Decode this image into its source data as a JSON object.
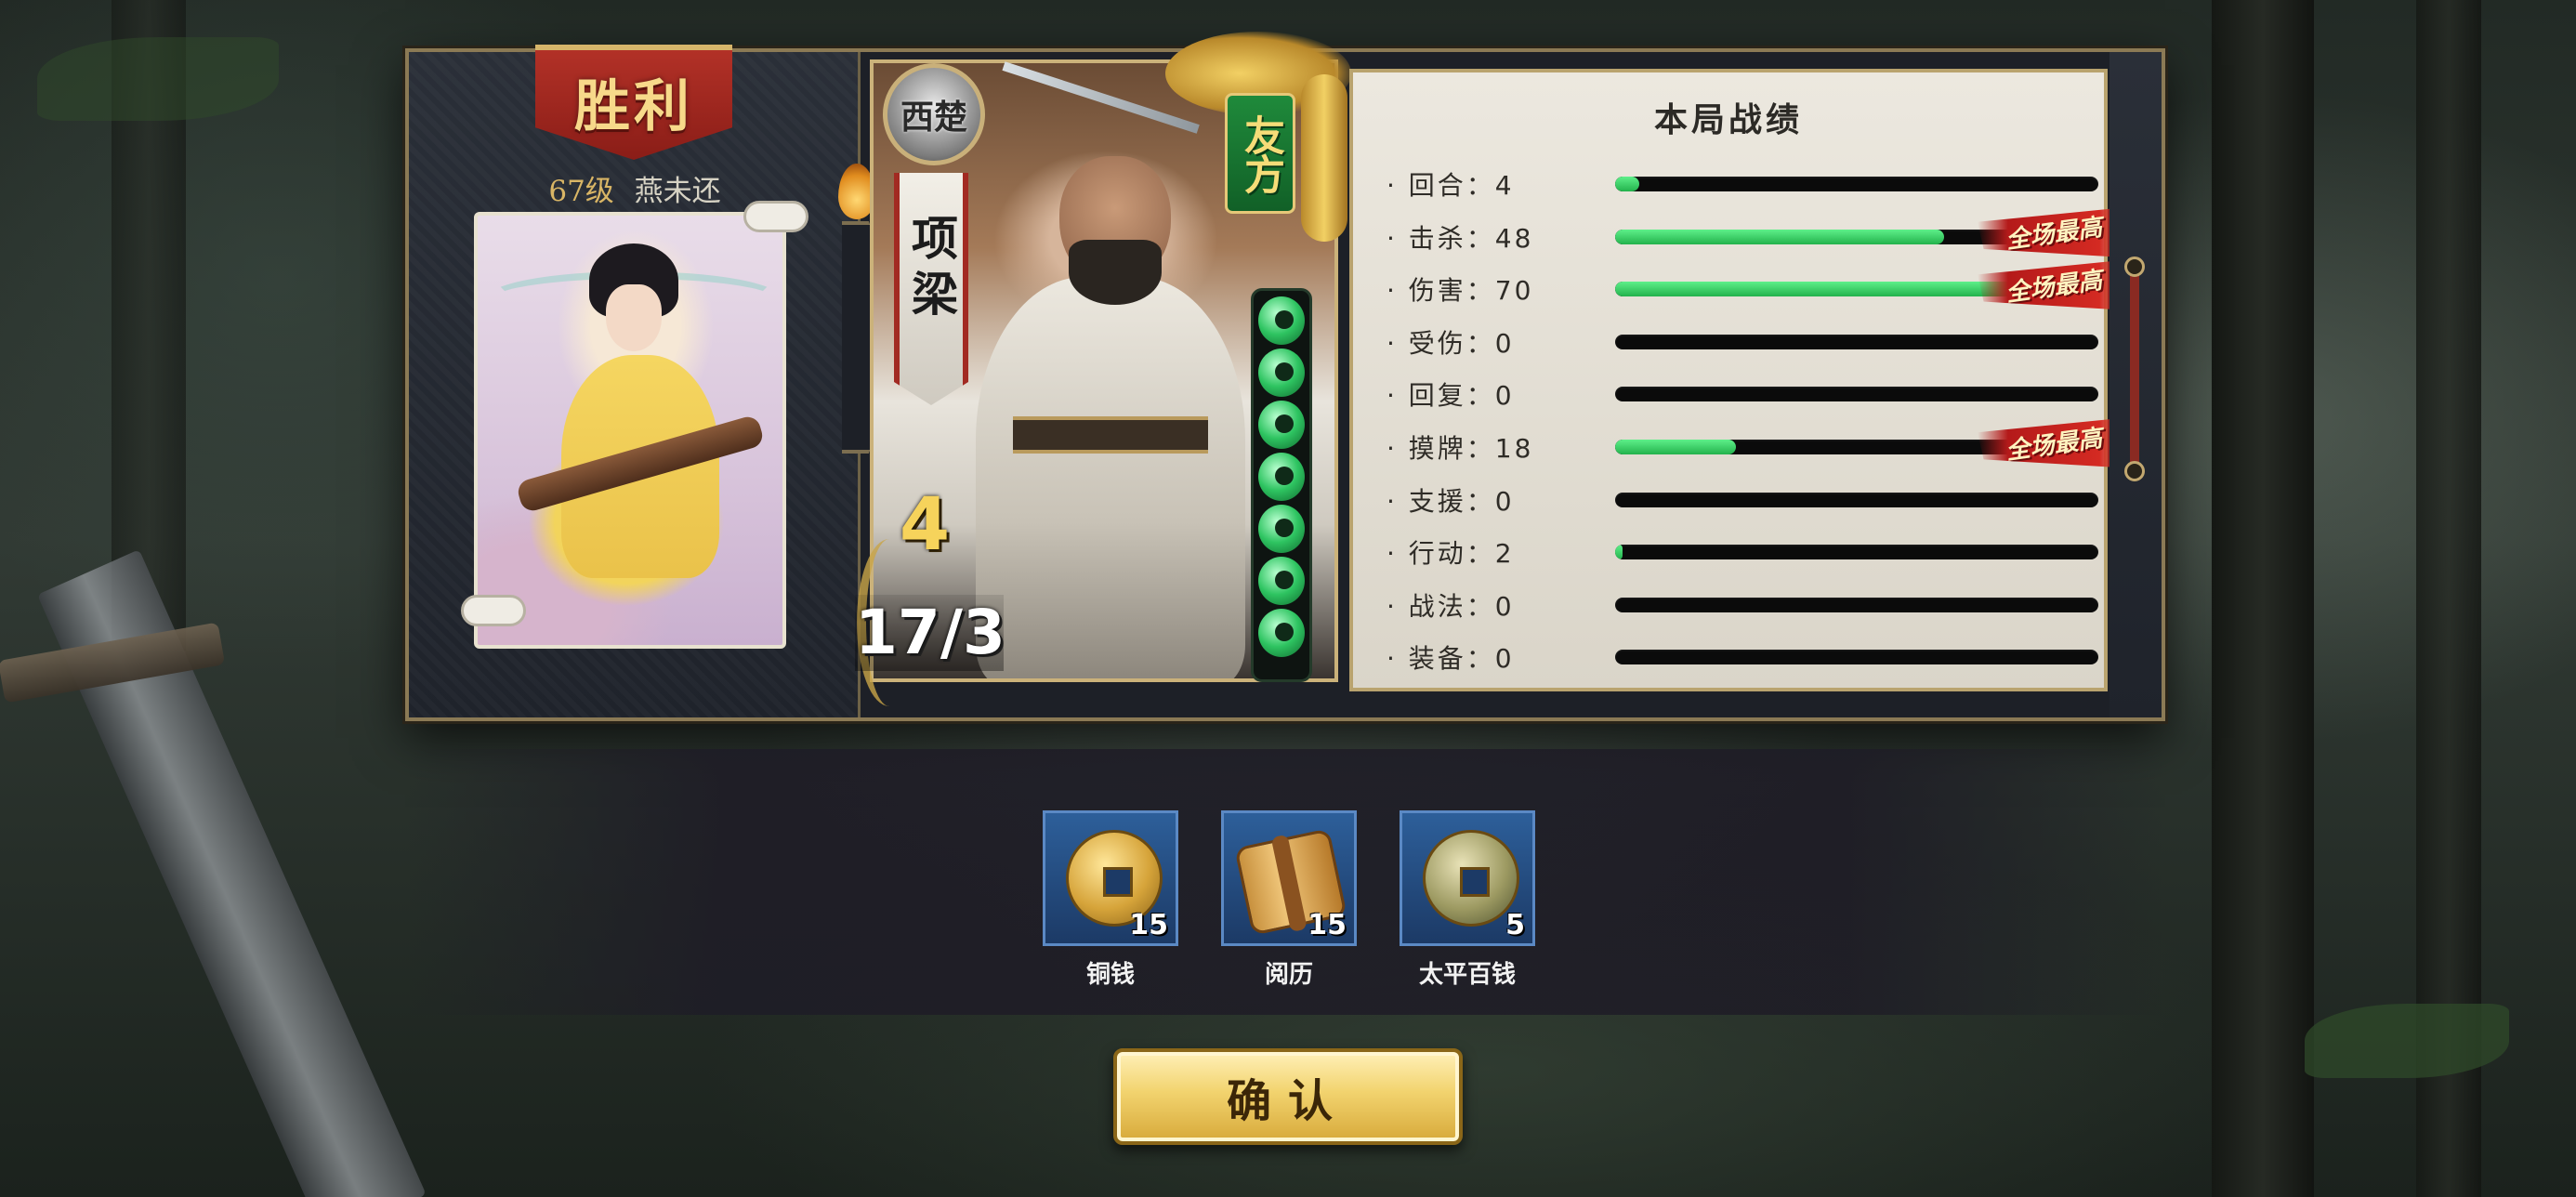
{
  "result": {
    "banner": "胜利",
    "player_level": "67级",
    "player_name": "燕未还"
  },
  "hero": {
    "faction": "西楚",
    "name": "项梁",
    "hp": "4",
    "kill_death": "17/3",
    "side": "友方",
    "hp_pips": 7
  },
  "stats": {
    "title": "本局战绩",
    "best_tag": "全场最高",
    "rows": [
      {
        "label": "· 回合：4",
        "fill": 0.05,
        "best": false
      },
      {
        "label": "· 击杀：48",
        "fill": 0.68,
        "best": true
      },
      {
        "label": "· 伤害：70",
        "fill": 1.0,
        "best": true
      },
      {
        "label": "· 受伤：0",
        "fill": 0.0,
        "best": false
      },
      {
        "label": "· 回复：0",
        "fill": 0.0,
        "best": false
      },
      {
        "label": "· 摸牌：18",
        "fill": 0.25,
        "best": true
      },
      {
        "label": "· 支援：0",
        "fill": 0.0,
        "best": false
      },
      {
        "label": "· 行动：2",
        "fill": 0.015,
        "best": false
      },
      {
        "label": "· 战法：0",
        "fill": 0.0,
        "best": false
      },
      {
        "label": "· 装备：0",
        "fill": 0.0,
        "best": false
      }
    ]
  },
  "rewards": [
    {
      "name": "铜钱",
      "qty": "15",
      "icon": "copper-coin-icon"
    },
    {
      "name": "阅历",
      "qty": "15",
      "icon": "scroll-icon"
    },
    {
      "name": "太平百钱",
      "qty": "5",
      "icon": "taiping-coin-icon"
    }
  ],
  "confirm_label": "确认",
  "colors": {
    "bar_fill": "#2fc458",
    "banner_red": "#b23127",
    "side_green": "#1f8a3b",
    "gold": "#f2d36e"
  }
}
